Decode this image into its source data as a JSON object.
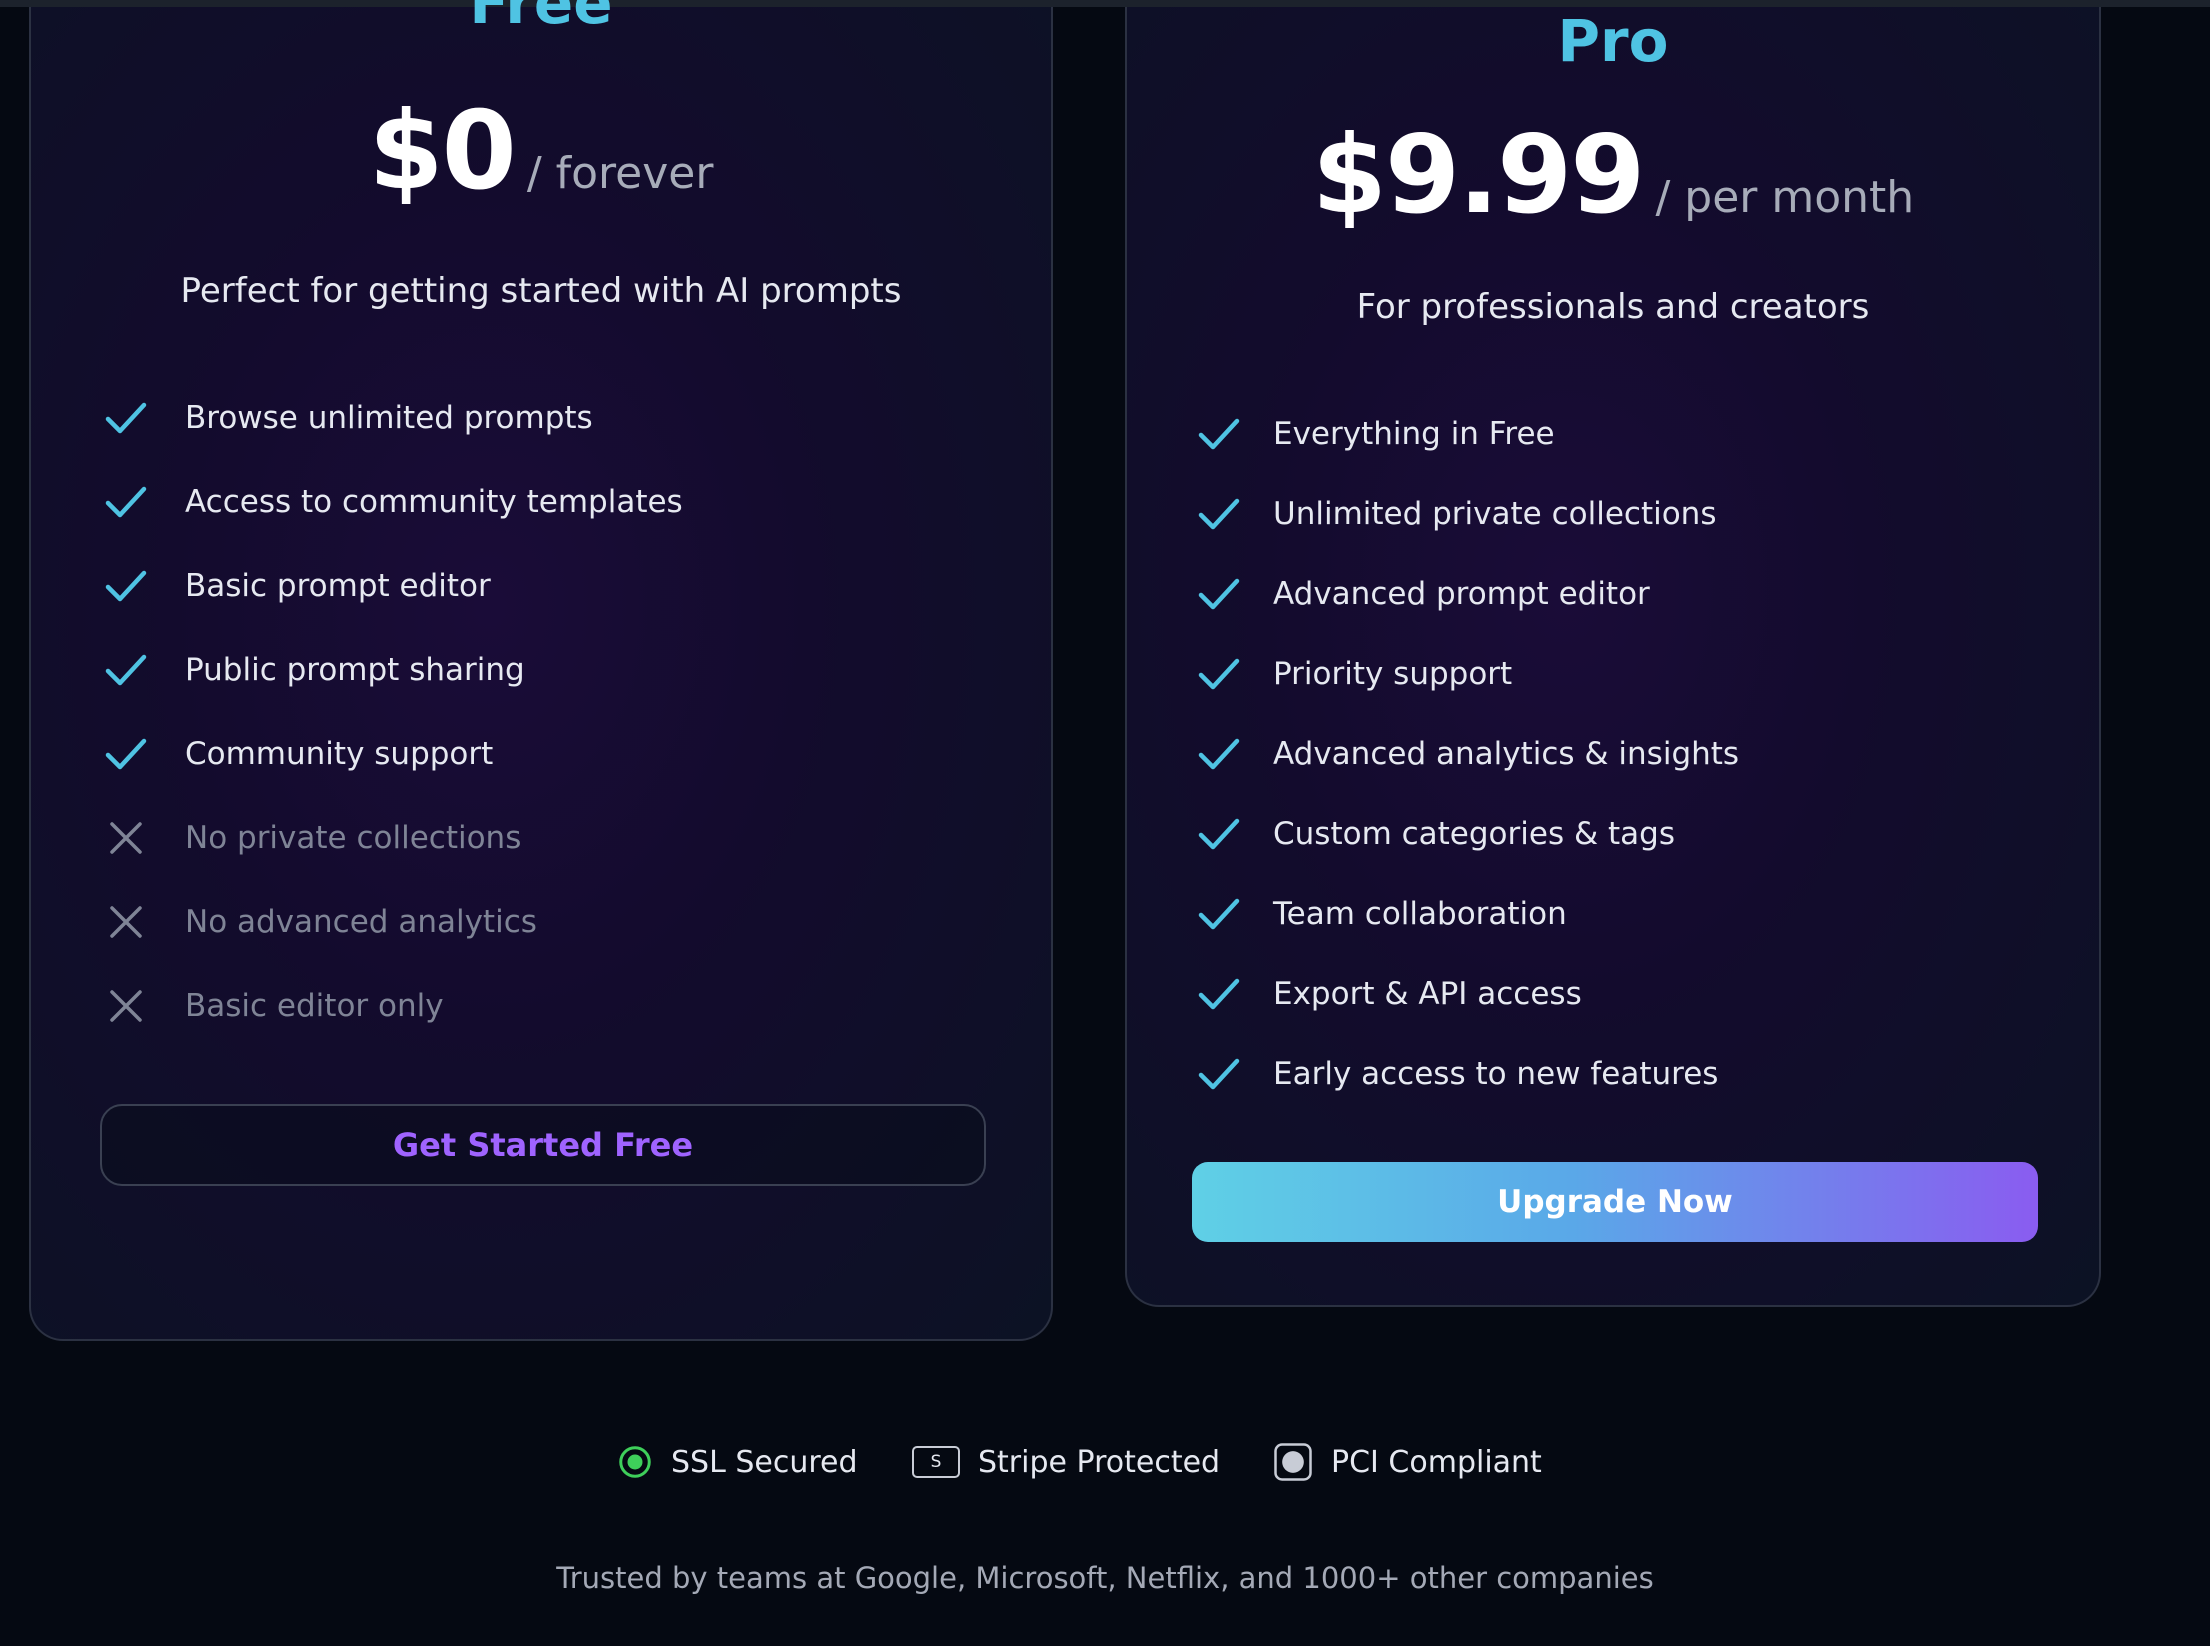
{
  "plans": {
    "free": {
      "name": "Free",
      "price": "$0",
      "period": "/ forever",
      "description": "Perfect for getting started with AI prompts",
      "features": [
        {
          "label": "Browse unlimited prompts",
          "included": true
        },
        {
          "label": "Access to community templates",
          "included": true
        },
        {
          "label": "Basic prompt editor",
          "included": true
        },
        {
          "label": "Public prompt sharing",
          "included": true
        },
        {
          "label": "Community support",
          "included": true
        },
        {
          "label": "No private collections",
          "included": false
        },
        {
          "label": "No advanced analytics",
          "included": false
        },
        {
          "label": "Basic editor only",
          "included": false
        }
      ],
      "cta": "Get Started Free"
    },
    "pro": {
      "name": "Pro",
      "price": "$9.99",
      "period": "/ per month",
      "description": "For professionals and creators",
      "features": [
        {
          "label": "Everything in Free",
          "included": true
        },
        {
          "label": "Unlimited private collections",
          "included": true
        },
        {
          "label": "Advanced prompt editor",
          "included": true
        },
        {
          "label": "Priority support",
          "included": true
        },
        {
          "label": "Advanced analytics & insights",
          "included": true
        },
        {
          "label": "Custom categories & tags",
          "included": true
        },
        {
          "label": "Team collaboration",
          "included": true
        },
        {
          "label": "Export & API access",
          "included": true
        },
        {
          "label": "Early access to new features",
          "included": true
        }
      ],
      "cta": "Upgrade Now"
    }
  },
  "trust_badges": [
    {
      "label": "SSL Secured",
      "icon": "ssl-radio-icon"
    },
    {
      "label": "Stripe Protected",
      "icon": "stripe-s-icon",
      "icon_text": "S"
    },
    {
      "label": "PCI Compliant",
      "icon": "pci-circle-icon"
    }
  ],
  "trusted_text": "Trusted by teams at Google, Microsoft, Netflix, and 1000+ other companies",
  "colors": {
    "background": "#050912",
    "accent_cyan": "#4fc3e3",
    "accent_purple": "#9f63ff",
    "check": "#4fc3e3",
    "cross": "#7f8496",
    "badge_green": "#3ecf5a"
  }
}
